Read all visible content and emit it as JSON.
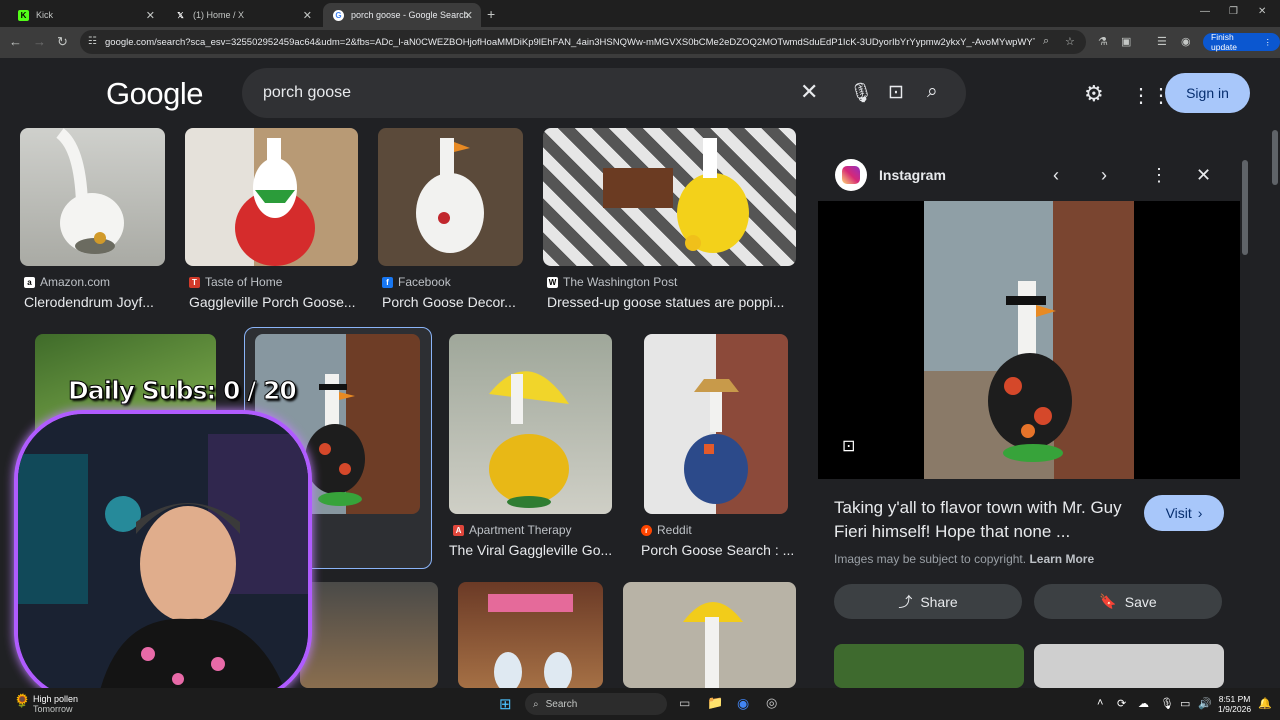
{
  "browser": {
    "tabs": [
      {
        "label": "Kick",
        "active": false
      },
      {
        "label": "(1) Home / X",
        "active": false
      },
      {
        "label": "porch goose - Google Search",
        "active": true
      }
    ],
    "url": "google.com/search?sca_esv=325502952459ac64&udm=2&fbs=ADc_l-aN0CWEZBOHjofHoaMMDiKp9lEhFAN_4ain3HSNQWw-mMGVXS0bCMe2eDZOQ2MOTwmdSduEdP1IcK-3UDyorIbYrYypmw2ykxY_-AvoMYwpWYTdBoJYN...",
    "finish_update": "Finish update"
  },
  "google": {
    "logo": "Google",
    "query": "porch goose",
    "signin": "Sign in"
  },
  "results": [
    {
      "source": "Amazon.com",
      "title": "Clerodendrum Joyf..."
    },
    {
      "source": "Taste of Home",
      "title": "Gaggleville Porch Goose..."
    },
    {
      "source": "Facebook",
      "title": "Porch Goose Decor..."
    },
    {
      "source": "The Washington Post",
      "title": "Dressed-up goose statues are poppi..."
    },
    {
      "source": "Instagram",
      "title": "Taking y'all to flavor town with Mr. Guy..."
    },
    {
      "source": "Apartment Therapy",
      "title": "The Viral Gaggleville Go..."
    },
    {
      "source": "Reddit",
      "title": "Porch Goose Search : ..."
    }
  ],
  "panel": {
    "source": "Instagram",
    "title": "Taking y'all to flavor town with Mr. Guy Fieri himself! Hope that none ...",
    "visit": "Visit",
    "copyright": "Images may be subject to copyright.",
    "learn_more": "Learn More",
    "share": "Share",
    "save": "Save"
  },
  "overlay": {
    "daily_subs": "Daily Subs:  0 / 20"
  },
  "taskbar": {
    "weather_title": "High pollen",
    "weather_sub": "Tomorrow",
    "search": "Search",
    "time": "8:51 PM",
    "date": "1/9/2026"
  },
  "colors": {
    "accent": "#a8c7fa",
    "background": "#202124",
    "webcam_border": "#b05cff"
  }
}
